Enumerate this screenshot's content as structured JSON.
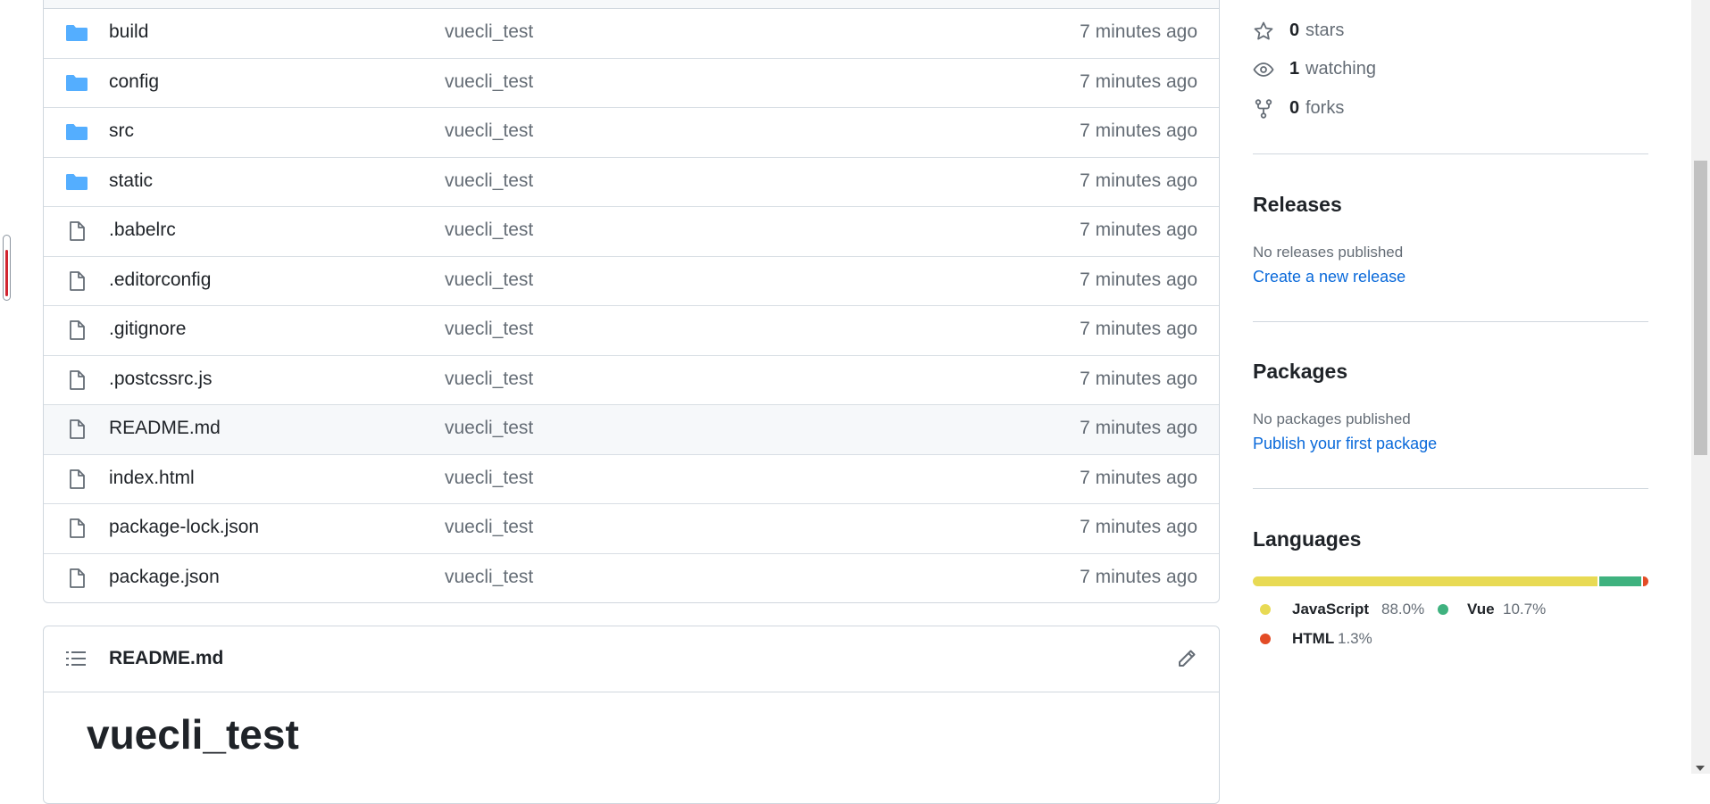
{
  "files": [
    {
      "type": "folder",
      "name": "build",
      "commit": "vuecli_test",
      "age": "7 minutes ago"
    },
    {
      "type": "folder",
      "name": "config",
      "commit": "vuecli_test",
      "age": "7 minutes ago"
    },
    {
      "type": "folder",
      "name": "src",
      "commit": "vuecli_test",
      "age": "7 minutes ago"
    },
    {
      "type": "folder",
      "name": "static",
      "commit": "vuecli_test",
      "age": "7 minutes ago"
    },
    {
      "type": "file",
      "name": ".babelrc",
      "commit": "vuecli_test",
      "age": "7 minutes ago"
    },
    {
      "type": "file",
      "name": ".editorconfig",
      "commit": "vuecli_test",
      "age": "7 minutes ago"
    },
    {
      "type": "file",
      "name": ".gitignore",
      "commit": "vuecli_test",
      "age": "7 minutes ago"
    },
    {
      "type": "file",
      "name": ".postcssrc.js",
      "commit": "vuecli_test",
      "age": "7 minutes ago"
    },
    {
      "type": "file",
      "name": "README.md",
      "commit": "vuecli_test",
      "age": "7 minutes ago"
    },
    {
      "type": "file",
      "name": "index.html",
      "commit": "vuecli_test",
      "age": "7 minutes ago"
    },
    {
      "type": "file",
      "name": "package-lock.json",
      "commit": "vuecli_test",
      "age": "7 minutes ago"
    },
    {
      "type": "file",
      "name": "package.json",
      "commit": "vuecli_test",
      "age": "7 minutes ago"
    }
  ],
  "readme": {
    "filename": "README.md",
    "heading": "vuecli_test"
  },
  "sidebar": {
    "stars": {
      "count": "0",
      "label": "stars"
    },
    "watching": {
      "count": "1",
      "label": "watching"
    },
    "forks": {
      "count": "0",
      "label": "forks"
    },
    "releases": {
      "title": "Releases",
      "empty": "No releases published",
      "link": "Create a new release"
    },
    "packages": {
      "title": "Packages",
      "empty": "No packages published",
      "link": "Publish your first package"
    },
    "languages": {
      "title": "Languages",
      "items": [
        {
          "name": "JavaScript",
          "percent": "88.0%",
          "share": 88.0,
          "color": "#e8da54"
        },
        {
          "name": "Vue",
          "percent": "10.7%",
          "share": 10.7,
          "color": "#3fb27f"
        },
        {
          "name": "HTML",
          "percent": "1.3%",
          "share": 1.3,
          "color": "#e34c26"
        }
      ]
    }
  },
  "colors": {
    "link": "#0969da",
    "folder": "#54aeff",
    "scroll_indicator": "#d1242f"
  }
}
